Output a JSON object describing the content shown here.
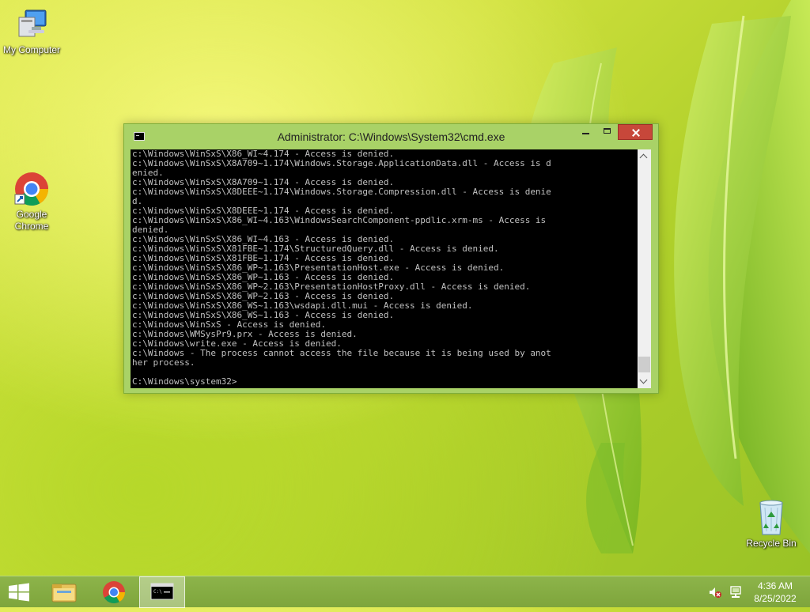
{
  "desktop": {
    "icons": [
      {
        "label": "My Computer",
        "icon": "computer-icon"
      },
      {
        "label": "Google Chrome",
        "icon": "chrome-icon"
      },
      {
        "label": "Recycle Bin",
        "icon": "recycle-bin-icon"
      }
    ]
  },
  "window": {
    "title": "Administrator: C:\\Windows\\System32\\cmd.exe",
    "icon": "cmd-icon",
    "console_lines": [
      "c:\\Windows\\WinSxS\\X86_WI~4.174 - Access is denied.",
      "c:\\Windows\\WinSxS\\X8A709~1.174\\Windows.Storage.ApplicationData.dll - Access is d",
      "enied.",
      "c:\\Windows\\WinSxS\\X8A709~1.174 - Access is denied.",
      "c:\\Windows\\WinSxS\\X8DEEE~1.174\\Windows.Storage.Compression.dll - Access is denie",
      "d.",
      "c:\\Windows\\WinSxS\\X8DEEE~1.174 - Access is denied.",
      "c:\\Windows\\WinSxS\\X86_WI~4.163\\WindowsSearchComponent-ppdlic.xrm-ms - Access is",
      "denied.",
      "c:\\Windows\\WinSxS\\X86_WI~4.163 - Access is denied.",
      "c:\\Windows\\WinSxS\\X81FBE~1.174\\StructuredQuery.dll - Access is denied.",
      "c:\\Windows\\WinSxS\\X81FBE~1.174 - Access is denied.",
      "c:\\Windows\\WinSxS\\X86_WP~1.163\\PresentationHost.exe - Access is denied.",
      "c:\\Windows\\WinSxS\\X86_WP~1.163 - Access is denied.",
      "c:\\Windows\\WinSxS\\X86_WP~2.163\\PresentationHostProxy.dll - Access is denied.",
      "c:\\Windows\\WinSxS\\X86_WP~2.163 - Access is denied.",
      "c:\\Windows\\WinSxS\\X86_WS~1.163\\wsdapi.dll.mui - Access is denied.",
      "c:\\Windows\\WinSxS\\X86_WS~1.163 - Access is denied.",
      "c:\\Windows\\WinSxS - Access is denied.",
      "c:\\Windows\\WMSysPr9.prx - Access is denied.",
      "c:\\Windows\\write.exe - Access is denied.",
      "c:\\Windows - The process cannot access the file because it is being used by anot",
      "her process."
    ],
    "prompt": "C:\\Windows\\system32>"
  },
  "taskbar": {
    "items": [
      {
        "name": "start",
        "icon": "windows-logo-icon"
      },
      {
        "name": "file-explorer",
        "icon": "folder-icon"
      },
      {
        "name": "chrome",
        "icon": "chrome-icon"
      },
      {
        "name": "cmd",
        "icon": "cmd-icon",
        "active": true
      }
    ],
    "tray": {
      "speaker_icon": "speaker-muted-icon",
      "network_icon": "network-icon",
      "time": "4:36 AM",
      "date": "8/25/2022"
    }
  },
  "colors": {
    "console_bg": "#000000",
    "console_text": "#c0c0c0",
    "window_frame": "#a9d267",
    "close_button": "#c7473a"
  }
}
